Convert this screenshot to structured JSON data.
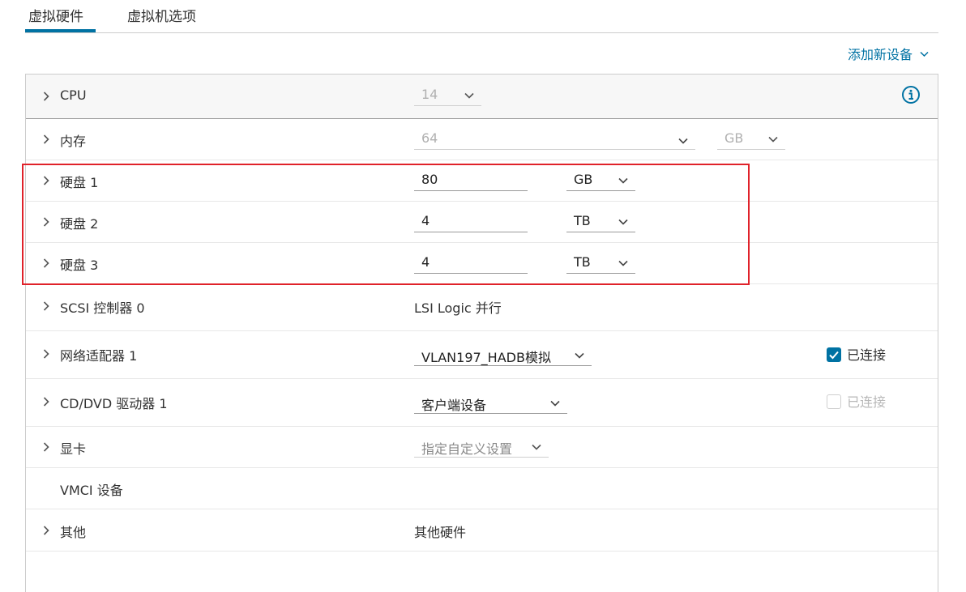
{
  "tabs": {
    "virtual_hardware": "虚拟硬件",
    "vm_options": "虚拟机选项"
  },
  "add_device": {
    "label": "添加新设备"
  },
  "rows": {
    "cpu": {
      "label": "CPU",
      "value": "14"
    },
    "memory": {
      "label": "内存",
      "value": "64",
      "unit": "GB"
    },
    "disk1": {
      "label": "硬盘 1",
      "value": "80",
      "unit": "GB"
    },
    "disk2": {
      "label": "硬盘 2",
      "value": "4",
      "unit": "TB"
    },
    "disk3": {
      "label": "硬盘 3",
      "value": "4",
      "unit": "TB"
    },
    "scsi": {
      "label": "SCSI 控制器 0",
      "value": "LSI Logic 并行"
    },
    "network": {
      "label": "网络适配器 1",
      "value": "VLAN197_HADB模拟",
      "connected_label": "已连接",
      "connected": true
    },
    "cddvd": {
      "label": "CD/DVD 驱动器 1",
      "value": "客户端设备",
      "connected_label": "已连接",
      "connected": false
    },
    "video": {
      "label": "显卡",
      "value": "指定自定义设置"
    },
    "vmci": {
      "label": "VMCI 设备"
    },
    "other": {
      "label": "其他",
      "value": "其他硬件"
    }
  },
  "colors": {
    "accent": "#0072a3",
    "highlight": "#e0222a",
    "disabled_text": "#b0b0b0"
  }
}
